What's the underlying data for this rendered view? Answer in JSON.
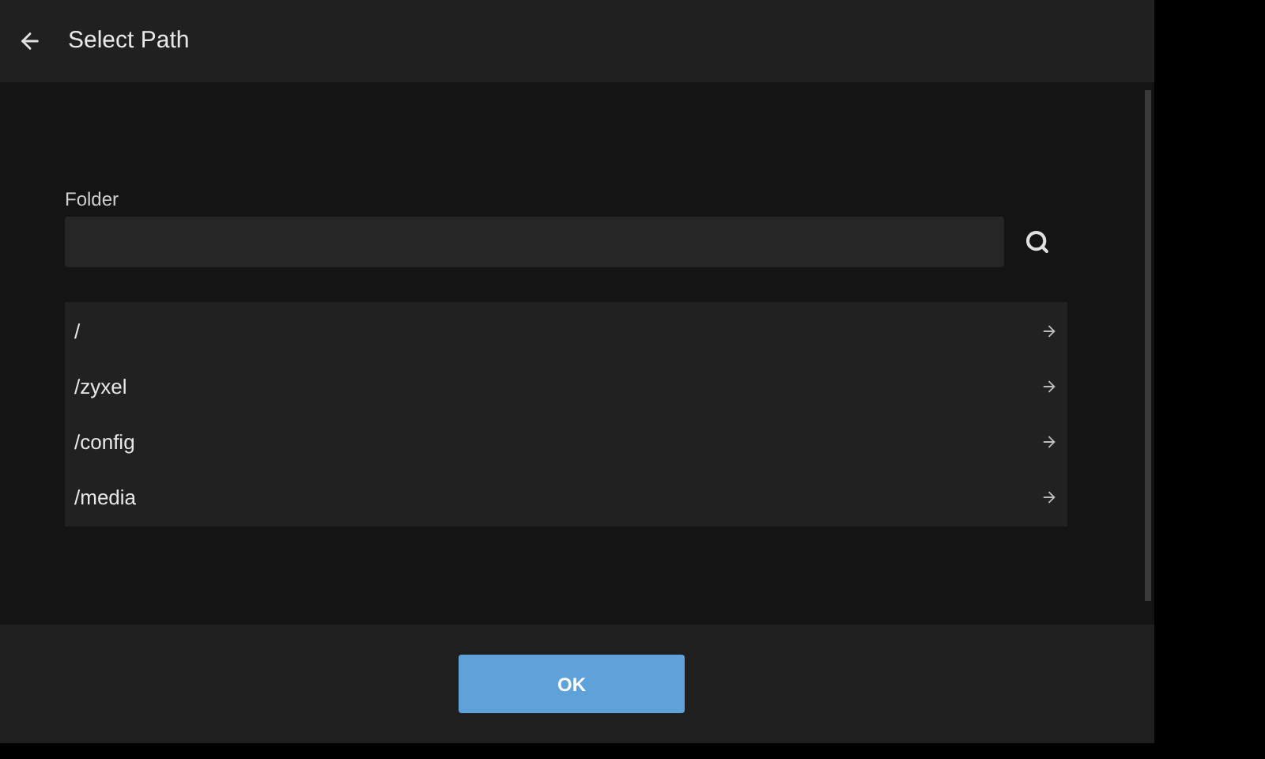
{
  "header": {
    "title": "Select Path"
  },
  "folder_field": {
    "label": "Folder"
  },
  "paths": [
    {
      "label": "/"
    },
    {
      "label": "/zyxel"
    },
    {
      "label": "/config"
    },
    {
      "label": "/media"
    }
  ],
  "footer": {
    "button": "OK"
  }
}
